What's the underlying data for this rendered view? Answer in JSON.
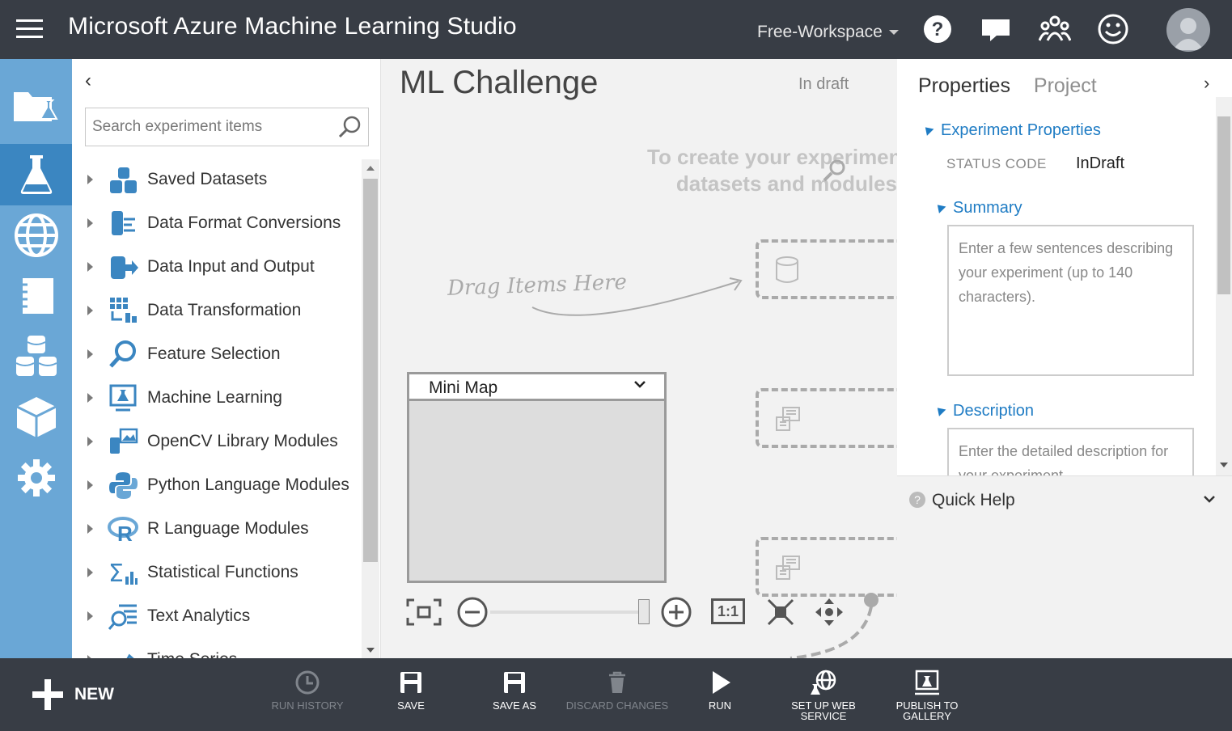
{
  "topbar": {
    "title": "Microsoft Azure Machine Learning Studio",
    "workspace": "Free-Workspace",
    "icons": [
      "hamburger-icon",
      "help-icon",
      "feedback-icon",
      "community-icon",
      "smiley-icon",
      "user-avatar"
    ]
  },
  "rail": {
    "items": [
      "projects-icon",
      "experiments-icon",
      "web-services-icon",
      "notebooks-icon",
      "datasets-icon",
      "trained-models-icon",
      "settings-icon"
    ],
    "active_index": 1
  },
  "palette": {
    "search_placeholder": "Search experiment items",
    "items": [
      {
        "label": "Saved Datasets",
        "icon": "saved-datasets-icon"
      },
      {
        "label": "Data Format Conversions",
        "icon": "data-format-icon"
      },
      {
        "label": "Data Input and Output",
        "icon": "data-io-icon"
      },
      {
        "label": "Data Transformation",
        "icon": "data-transformation-icon"
      },
      {
        "label": "Feature Selection",
        "icon": "feature-selection-icon"
      },
      {
        "label": "Machine Learning",
        "icon": "machine-learning-icon"
      },
      {
        "label": "OpenCV Library Modules",
        "icon": "opencv-icon"
      },
      {
        "label": "Python Language Modules",
        "icon": "python-icon"
      },
      {
        "label": "R Language Modules",
        "icon": "r-language-icon"
      },
      {
        "label": "Statistical Functions",
        "icon": "statistical-functions-icon"
      },
      {
        "label": "Text Analytics",
        "icon": "text-analytics-icon"
      },
      {
        "label": "Time Series",
        "icon": "time-series-icon"
      }
    ]
  },
  "canvas": {
    "experiment_title": "ML Challenge",
    "status": "In draft",
    "hint_line1": "To create your experiment, drag and drop",
    "hint_line2": "datasets and modules",
    "drag_hint": "Drag Items Here",
    "minimap_title": "Mini Map",
    "zoom_reset_label": "1:1",
    "zoom_level": 0.97
  },
  "properties": {
    "tabs": [
      "Properties",
      "Project"
    ],
    "section_title": "Experiment Properties",
    "status_code_label": "STATUS CODE",
    "status_code_value": "InDraft",
    "summary_title": "Summary",
    "summary_placeholder": "Enter a few sentences describing your experiment (up to 140 characters).",
    "description_title": "Description",
    "description_placeholder": "Enter the detailed description for your experiment.",
    "quick_help": "Quick Help"
  },
  "bottombar": {
    "new_label": "NEW",
    "commands": [
      {
        "label": "RUN HISTORY",
        "icon": "history-icon",
        "enabled": false
      },
      {
        "label": "SAVE",
        "icon": "save-icon",
        "enabled": true
      },
      {
        "label": "SAVE AS",
        "icon": "save-as-icon",
        "enabled": true
      },
      {
        "label": "DISCARD CHANGES",
        "icon": "trash-icon",
        "enabled": false
      },
      {
        "label": "RUN",
        "icon": "run-icon",
        "enabled": true
      },
      {
        "label": "SET UP WEB SERVICE",
        "icon": "web-service-icon",
        "enabled": true
      },
      {
        "label": "PUBLISH TO GALLERY",
        "icon": "publish-gallery-icon",
        "enabled": true
      }
    ]
  },
  "colors": {
    "topbar": "#383d45",
    "rail": "#6aa7d6",
    "rail_active": "#3b86c1",
    "accent": "#1f7cc4"
  }
}
